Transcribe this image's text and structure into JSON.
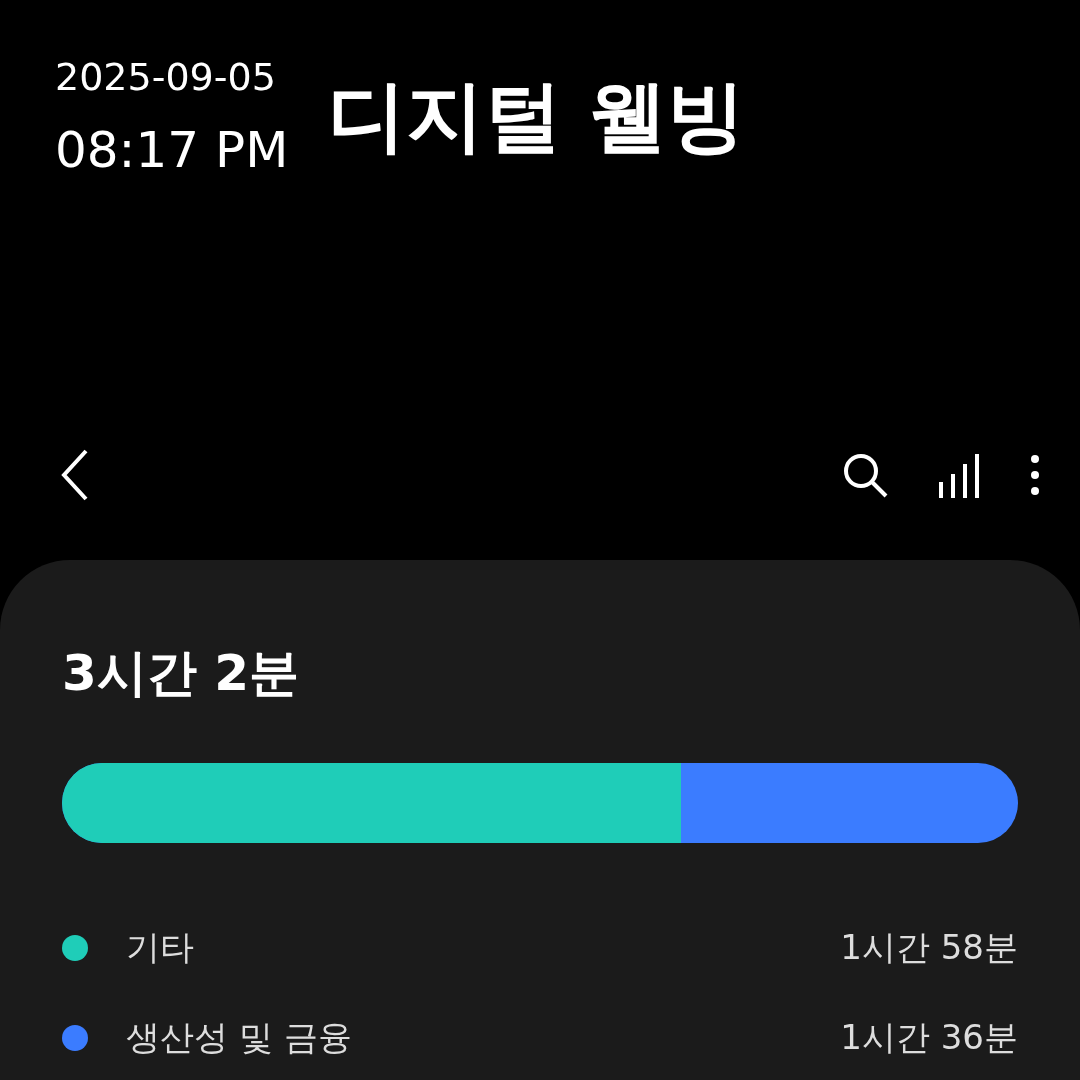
{
  "timestamp": {
    "date": "2025-09-05",
    "time": "08:17 PM"
  },
  "title": "디지털 웰빙",
  "card": {
    "total": "3시간 2분",
    "usage_bar": {
      "level": 0.647
    },
    "categories": [
      {
        "name": "기타",
        "time": "1시간 58분",
        "color": "#1fcdb8"
      },
      {
        "name": "생산성 및 금융",
        "time": "1시간 36분",
        "color": "#3b7cff"
      }
    ]
  }
}
